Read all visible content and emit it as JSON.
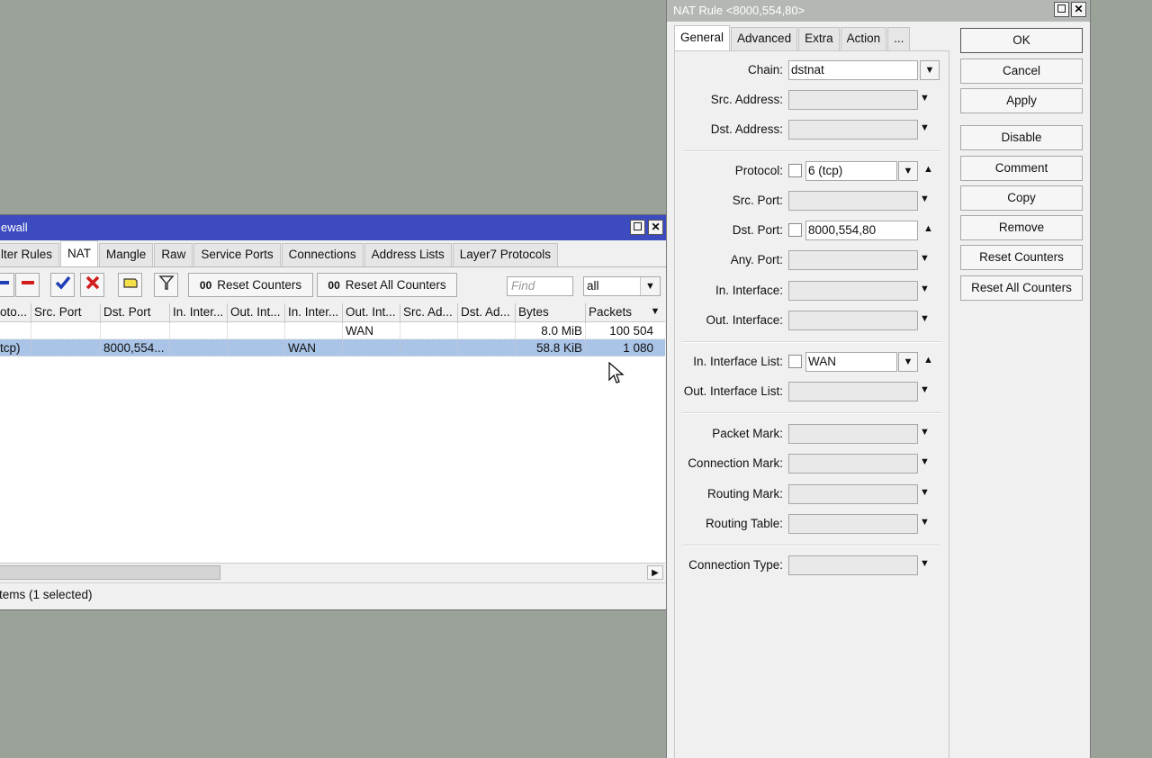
{
  "firewall": {
    "title": "ewall",
    "tabs": [
      "lter Rules",
      "NAT",
      "Mangle",
      "Raw",
      "Service Ports",
      "Connections",
      "Address Lists",
      "Layer7 Protocols"
    ],
    "active_tab": "NAT",
    "toolbar": {
      "reset_counters": "Reset Counters",
      "reset_all_counters": "Reset All Counters",
      "counter_glyph": "00",
      "find_placeholder": "Find",
      "filter_value": "all"
    },
    "columns": [
      "oto...",
      "Src. Port",
      "Dst. Port",
      "In. Inter...",
      "Out. Int...",
      "In. Inter...",
      "Out. Int...",
      "Src. Ad...",
      "Dst. Ad...",
      "Bytes",
      "Packets"
    ],
    "rows": [
      {
        "proto": "",
        "src_port": "",
        "dst_port": "",
        "in_inter": "",
        "out_int": "",
        "in_inter_list": "",
        "out_int_list": "WAN",
        "src_ad": "",
        "dst_ad": "",
        "bytes": "8.0 MiB",
        "packets": "100 504"
      },
      {
        "proto": "tcp)",
        "src_port": "",
        "dst_port": "8000,554...",
        "in_inter": "",
        "out_int": "",
        "in_inter_list": "WAN",
        "out_int_list": "",
        "src_ad": "",
        "dst_ad": "",
        "bytes": "58.8 KiB",
        "packets": "1 080"
      }
    ],
    "selected_row": 1,
    "status": "tems (1 selected)"
  },
  "nat_rule": {
    "title": "NAT Rule <8000,554,80>",
    "tabs": [
      "General",
      "Advanced",
      "Extra",
      "Action",
      "..."
    ],
    "active_tab": "General",
    "fields": {
      "chain": {
        "label": "Chain:",
        "value": "dstnat"
      },
      "src_address": {
        "label": "Src. Address:",
        "value": ""
      },
      "dst_address": {
        "label": "Dst. Address:",
        "value": ""
      },
      "protocol": {
        "label": "Protocol:",
        "value": "6 (tcp)"
      },
      "src_port": {
        "label": "Src. Port:",
        "value": ""
      },
      "dst_port": {
        "label": "Dst. Port:",
        "value": "8000,554,80"
      },
      "any_port": {
        "label": "Any. Port:",
        "value": ""
      },
      "in_interface": {
        "label": "In. Interface:",
        "value": ""
      },
      "out_interface": {
        "label": "Out. Interface:",
        "value": ""
      },
      "in_interface_list": {
        "label": "In. Interface List:",
        "value": "WAN"
      },
      "out_interface_list": {
        "label": "Out. Interface List:",
        "value": ""
      },
      "packet_mark": {
        "label": "Packet Mark:",
        "value": ""
      },
      "connection_mark": {
        "label": "Connection Mark:",
        "value": ""
      },
      "routing_mark": {
        "label": "Routing Mark:",
        "value": ""
      },
      "routing_table": {
        "label": "Routing Table:",
        "value": ""
      },
      "connection_type": {
        "label": "Connection Type:",
        "value": ""
      }
    },
    "buttons": {
      "ok": "OK",
      "cancel": "Cancel",
      "apply": "Apply",
      "disable": "Disable",
      "comment": "Comment",
      "copy": "Copy",
      "remove": "Remove",
      "reset_counters": "Reset Counters",
      "reset_all_counters": "Reset All Counters"
    }
  },
  "icons": {
    "add": "plus-icon",
    "remove": "minus-icon",
    "enable": "check-icon",
    "disable": "x-icon",
    "comment": "note-icon",
    "filter": "funnel-icon",
    "dropdown": "triangle-down-icon",
    "expand": "triangle-up-icon"
  },
  "colors": {
    "active_title": "#3c4bc0",
    "inactive_title": "#b4b8b4",
    "selection": "#a9c4e6",
    "desktop": "#9aa29a",
    "remove_red": "#d11d1d",
    "check_blue": "#1f3fb8"
  }
}
